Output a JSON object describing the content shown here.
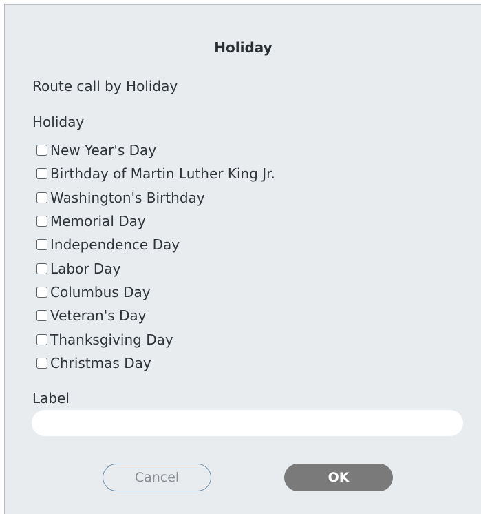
{
  "dialog": {
    "title": "Holiday",
    "subtitle": "Route call by Holiday",
    "holiday_section_label": "Holiday",
    "holidays": [
      {
        "label": "New Year's Day",
        "checked": false
      },
      {
        "label": "Birthday of Martin Luther King Jr.",
        "checked": false
      },
      {
        "label": "Washington's Birthday",
        "checked": false
      },
      {
        "label": "Memorial Day",
        "checked": false
      },
      {
        "label": "Independence Day",
        "checked": false
      },
      {
        "label": "Labor Day",
        "checked": false
      },
      {
        "label": "Columbus Day",
        "checked": false
      },
      {
        "label": "Veteran's Day",
        "checked": false
      },
      {
        "label": "Thanksgiving Day",
        "checked": false
      },
      {
        "label": "Christmas Day",
        "checked": false
      }
    ],
    "label_caption": "Label",
    "label_value": "",
    "cancel_label": "Cancel",
    "ok_label": "OK"
  },
  "colors": {
    "dialog_background": "#e9ecef",
    "ok_button": "#7a7a7a",
    "cancel_border": "#6f8fa8"
  }
}
